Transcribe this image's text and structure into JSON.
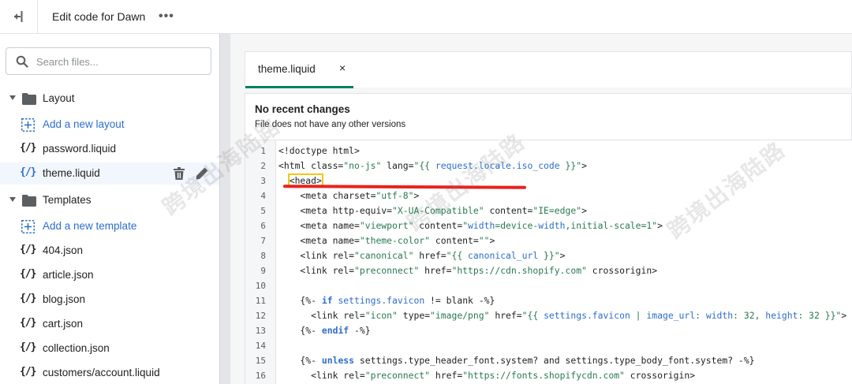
{
  "topbar": {
    "exit_icon": "exit-icon",
    "title": "Edit code for Dawn",
    "more_label": "•••"
  },
  "sidebar": {
    "search": {
      "placeholder": "Search files...",
      "value": ""
    },
    "layout": {
      "label": "Layout",
      "add_label": "Add a new layout",
      "files": [
        "password.liquid",
        "theme.liquid"
      ]
    },
    "templates": {
      "label": "Templates",
      "add_label": "Add a new template",
      "files": [
        "404.json",
        "article.json",
        "blog.json",
        "cart.json",
        "collection.json",
        "customers/account.liquid"
      ]
    },
    "file_icon_glyph": "{/}",
    "selected_file": "theme.liquid"
  },
  "editor": {
    "tab_label": "theme.liquid",
    "tab_close": "×",
    "status_title": "No recent changes",
    "status_subtitle": "File does not have any other versions",
    "code_lines": [
      {
        "n": "1",
        "text": "<!doctype html>"
      },
      {
        "n": "2",
        "text": "<html class=\"no-js\" lang=\"{{ request.locale.iso_code }}\">"
      },
      {
        "n": "3",
        "text": "  <head>"
      },
      {
        "n": "4",
        "text": "    <meta charset=\"utf-8\">"
      },
      {
        "n": "5",
        "text": "    <meta http-equiv=\"X-UA-Compatible\" content=\"IE=edge\">"
      },
      {
        "n": "6",
        "text": "    <meta name=\"viewport\" content=\"width=device-width,initial-scale=1\">"
      },
      {
        "n": "7",
        "text": "    <meta name=\"theme-color\" content=\"\">"
      },
      {
        "n": "8",
        "text": "    <link rel=\"canonical\" href=\"{{ canonical_url }}\">"
      },
      {
        "n": "9",
        "text": "    <link rel=\"preconnect\" href=\"https://cdn.shopify.com\" crossorigin>"
      },
      {
        "n": "10",
        "text": ""
      },
      {
        "n": "11",
        "text": "    {%- if settings.favicon != blank -%}"
      },
      {
        "n": "12",
        "text": "      <link rel=\"icon\" type=\"image/png\" href=\"{{ settings.favicon | image_url: width: 32, height: 32 }}\">"
      },
      {
        "n": "13",
        "text": "    {%- endif -%}"
      },
      {
        "n": "14",
        "text": ""
      },
      {
        "n": "15",
        "text": "    {%- unless settings.type_header_font.system? and settings.type_body_font.system? -%}"
      },
      {
        "n": "16",
        "text": "      <link rel=\"preconnect\" href=\"https://fonts.shopifycdn.com\" crossorigin>"
      }
    ],
    "highlight_line": "3",
    "annotation_color": "#e8231c",
    "highlight_color": "#f5c517"
  },
  "watermark": "跨境出海陆路",
  "colors": {
    "link": "#2c6ecb",
    "accent": "#008060",
    "string": "#287a50"
  }
}
